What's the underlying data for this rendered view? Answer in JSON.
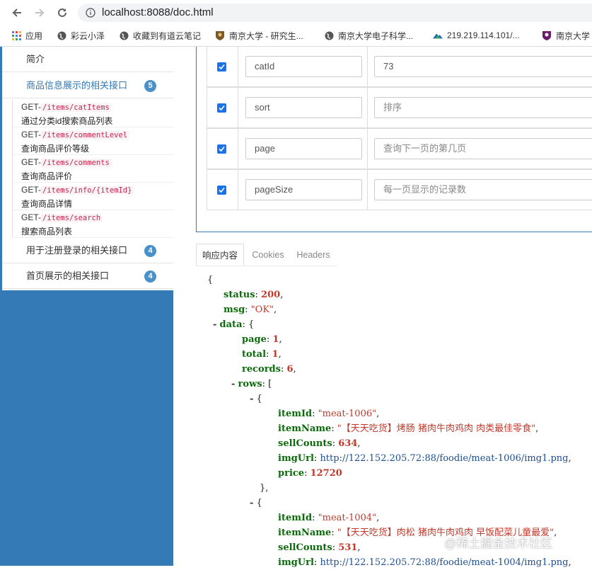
{
  "browser": {
    "url": "localhost:8088/doc.html",
    "bookmarks": [
      {
        "label": "应用",
        "icon": "apps-grid-icon"
      },
      {
        "label": "彩云小泽",
        "icon": "globe-icon"
      },
      {
        "label": "收藏到有道云笔记",
        "icon": "globe-icon"
      },
      {
        "label": "南京大学 - 研究生...",
        "icon": "university-crest-icon"
      },
      {
        "label": "南京大学电子科学...",
        "icon": "globe-icon"
      },
      {
        "label": "219.219.114.101/...",
        "icon": "mountain-logo-icon"
      },
      {
        "label": "南京大学",
        "icon": "university-crest-icon"
      }
    ]
  },
  "sidebar": {
    "intro": "简介",
    "group1": {
      "label": "商品信息展示的相关接口",
      "count": "5"
    },
    "apis": [
      {
        "method": "GET-",
        "path": "/items/catItems",
        "desc": "通过分类id搜索商品列表"
      },
      {
        "method": "GET-",
        "path": "/items/commentLevel",
        "desc": "查询商品评价等级"
      },
      {
        "method": "GET-",
        "path": "/items/comments",
        "desc": "查询商品评价"
      },
      {
        "method": "GET-",
        "path": "/items/info/{itemId}",
        "desc": "查询商品详情"
      },
      {
        "method": "GET-",
        "path": "/items/search",
        "desc": "搜索商品列表"
      }
    ],
    "group2": {
      "label": "用于注册登录的相关接口",
      "count": "4"
    },
    "group3": {
      "label": "首页展示的相关接口",
      "count": "4"
    }
  },
  "params": [
    {
      "name": "catId",
      "value": "73",
      "placeholder": ""
    },
    {
      "name": "sort",
      "value": "",
      "placeholder": "排序"
    },
    {
      "name": "page",
      "value": "",
      "placeholder": "查询下一页的第几页"
    },
    {
      "name": "pageSize",
      "value": "",
      "placeholder": "每一页显示的记录数"
    }
  ],
  "tabs": [
    "响应内容",
    "Cookies",
    "Headers"
  ],
  "response": {
    "open_brace": "{",
    "status_key": "status",
    "status_val": "200",
    "msg_key": "msg",
    "msg_val": "\"OK\"",
    "data_key": "data",
    "page_key": "page",
    "page_val": "1",
    "total_key": "total",
    "total_val": "1",
    "records_key": "records",
    "records_val": "6",
    "rows_key": "rows",
    "items": [
      {
        "itemId": "\"meat-1006\"",
        "itemName": "\"【天天吃货】烤肠 猪肉牛肉鸡肉 肉类最佳零食\"",
        "sellCounts": "634",
        "imgUrl": "http://122.152.205.72:88/foodie/meat-1006/img1.png",
        "price": "12720"
      },
      {
        "itemId": "\"meat-1004\"",
        "itemName": "\"【天天吃货】肉松 猪肉牛肉鸡肉 早饭配菜儿童最爱\"",
        "sellCounts": "531",
        "imgUrl": "http://122.152.205.72:88/foodie/meat-1004/img1.png"
      }
    ],
    "keys": {
      "itemId": "itemId",
      "itemName": "itemName",
      "sellCounts": "sellCounts",
      "imgUrl": "imgUrl",
      "price": "price"
    }
  },
  "watermark": "@稀土掘金技术社区",
  "colors": {
    "accent": "#337ab7",
    "key": "#0b6b0b",
    "value": "#c0392b",
    "link": "#1d4e8f"
  }
}
